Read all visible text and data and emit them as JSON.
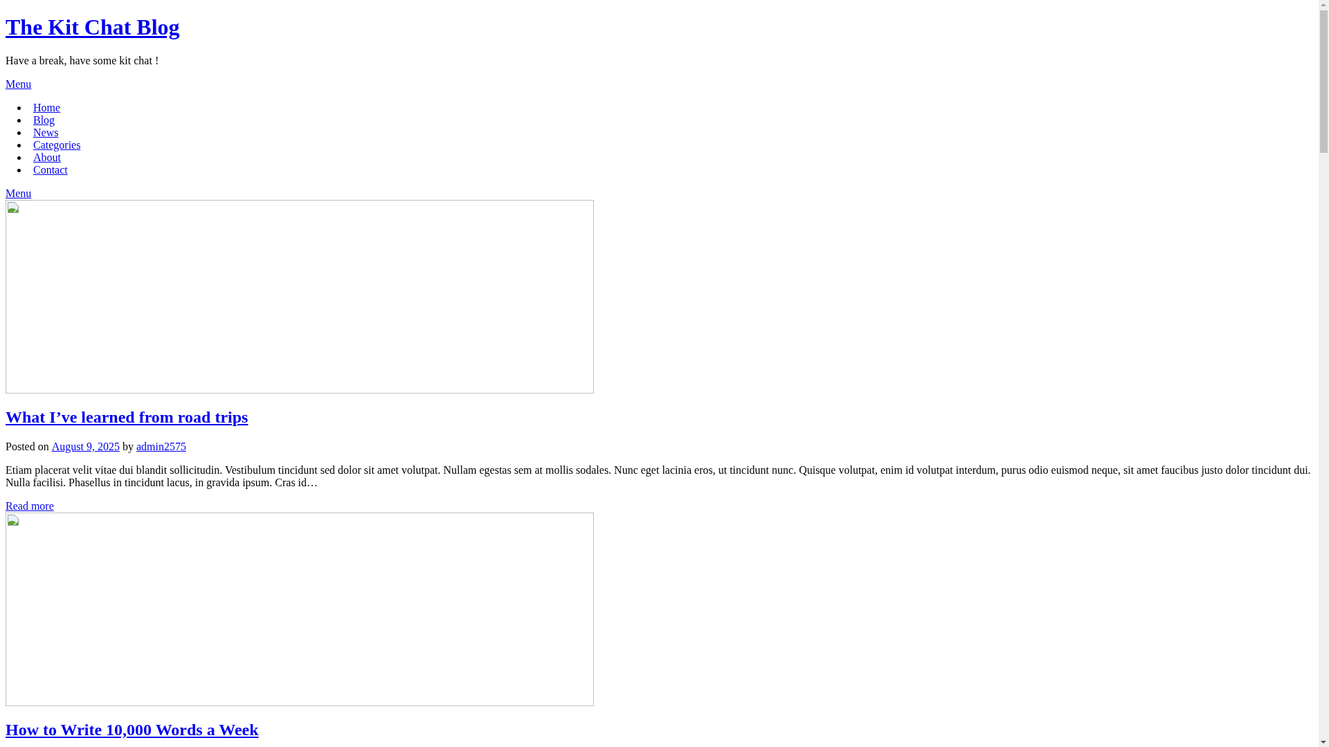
{
  "site": {
    "title": "The Kit Chat Blog",
    "tagline": "Have a break, have some kit chat !",
    "menu_toggle": "Menu"
  },
  "nav": {
    "items": [
      {
        "label": "Home"
      },
      {
        "label": "Blog"
      },
      {
        "label": "News"
      },
      {
        "label": "Categories"
      },
      {
        "label": "About"
      },
      {
        "label": "Contact"
      }
    ]
  },
  "secondary_menu_toggle": "Menu",
  "posts": [
    {
      "title": "What I’ve learned from road trips",
      "posted_label": "Posted on",
      "date": "August 9, 2025",
      "by_label": "by",
      "author": "admin2575",
      "excerpt": "Etiam placerat velit vitae dui blandit sollicitudin. Vestibulum tincidunt sed dolor sit amet volutpat. Nullam egestas sem at mollis sodales. Nunc eget lacinia eros, ut tincidunt nunc. Quisque volutpat, enim id volutpat interdum, purus odio euismod neque, sit amet faucibus justo dolor tincidunt dui. Nulla facilisi. Phasellus in tincidunt lacus, in gravida ipsum. Cras id…",
      "read_more": "Read more"
    },
    {
      "title": "How to Write 10,000 Words a Week"
    }
  ]
}
